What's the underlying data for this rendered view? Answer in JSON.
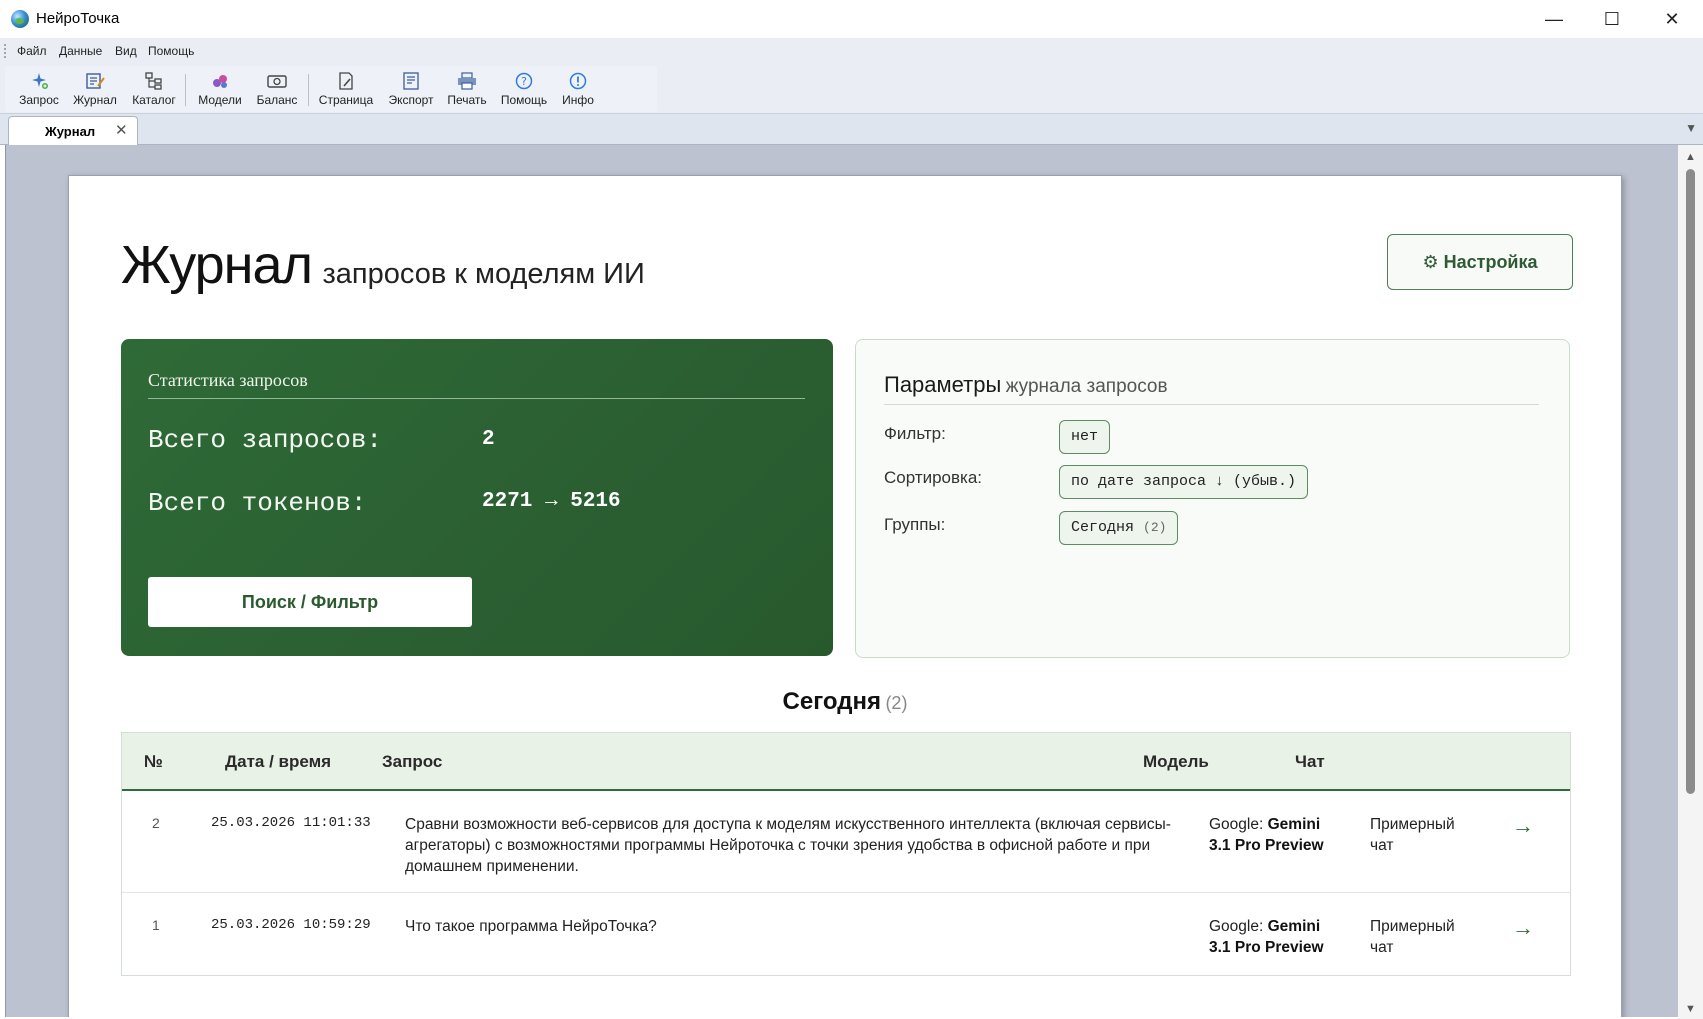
{
  "window": {
    "title": "НейроТочка",
    "minimize": "—",
    "maximize": "☐",
    "close": "✕"
  },
  "menu": [
    "Файл",
    "Данные",
    "Вид",
    "Помощь"
  ],
  "toolbar": [
    {
      "label": "Запрос",
      "icon": "sparkle-plus-icon"
    },
    {
      "label": "Журнал",
      "icon": "journal-edit-icon"
    },
    {
      "label": "Каталог",
      "icon": "catalog-tree-icon"
    },
    {
      "label": "Модели",
      "icon": "models-cubes-icon"
    },
    {
      "label": "Баланс",
      "icon": "wallet-balance-icon"
    },
    {
      "label": "Страница",
      "icon": "page-edit-icon"
    },
    {
      "label": "Экспорт",
      "icon": "export-doc-icon"
    },
    {
      "label": "Печать",
      "icon": "printer-icon"
    },
    {
      "label": "Помощь",
      "icon": "help-circle-icon"
    },
    {
      "label": "Инфо",
      "icon": "info-icon"
    }
  ],
  "tab": {
    "label": "Журнал",
    "close": "✕",
    "dropdown": "▼"
  },
  "page": {
    "title_main": "Журнал",
    "title_sub": "запросов к моделям ИИ",
    "settings_button": "⚙ Настройка"
  },
  "stats": {
    "title": "Статистика запросов",
    "total_requests_label": "Всего запросов:",
    "total_requests_value": "2",
    "total_tokens_label": "Всего токенов:",
    "total_tokens_value": "2271 → 5216",
    "search_button": "Поиск / Фильтр"
  },
  "params": {
    "title_bold": "Параметры",
    "title_rest": "журнала запросов",
    "filter_label": "Фильтр:",
    "filter_value": "нет",
    "sort_label": "Сортировка:",
    "sort_value": "по дате запроса ↓ (убыв.)",
    "groups_label": "Группы:",
    "groups_value": "Сегодня",
    "groups_count": "(2)"
  },
  "group": {
    "title": "Сегодня",
    "count": "(2)"
  },
  "table": {
    "headers": {
      "num": "№",
      "date": "Дата / время",
      "query": "Запрос",
      "model": "Модель",
      "chat": "Чат"
    },
    "rows": [
      {
        "num": "2",
        "date": "25.03.2026 11:01:33",
        "query": "Сравни возможности веб-сервисов для доступа к моделям искусственного интеллекта (включая сервисы-агрегаторы) с возможностями программы Нейроточка с точки зрения удобства в офисной работе и при домашнем применении.",
        "model_provider": "Google:",
        "model_name": "Gemini 3.1 Pro Preview",
        "chat": "Примерный чат",
        "go": "→"
      },
      {
        "num": "1",
        "date": "25.03.2026 10:59:29",
        "query": "Что такое программа НейроТочка?",
        "model_provider": "Google:",
        "model_name": "Gemini 3.1 Pro Preview",
        "chat": "Примерный чат",
        "go": "→"
      }
    ]
  },
  "colors": {
    "accent_green": "#2e6a37",
    "header_green_bg": "#e8f2e6",
    "viewport_bg": "#bcc2d0"
  }
}
